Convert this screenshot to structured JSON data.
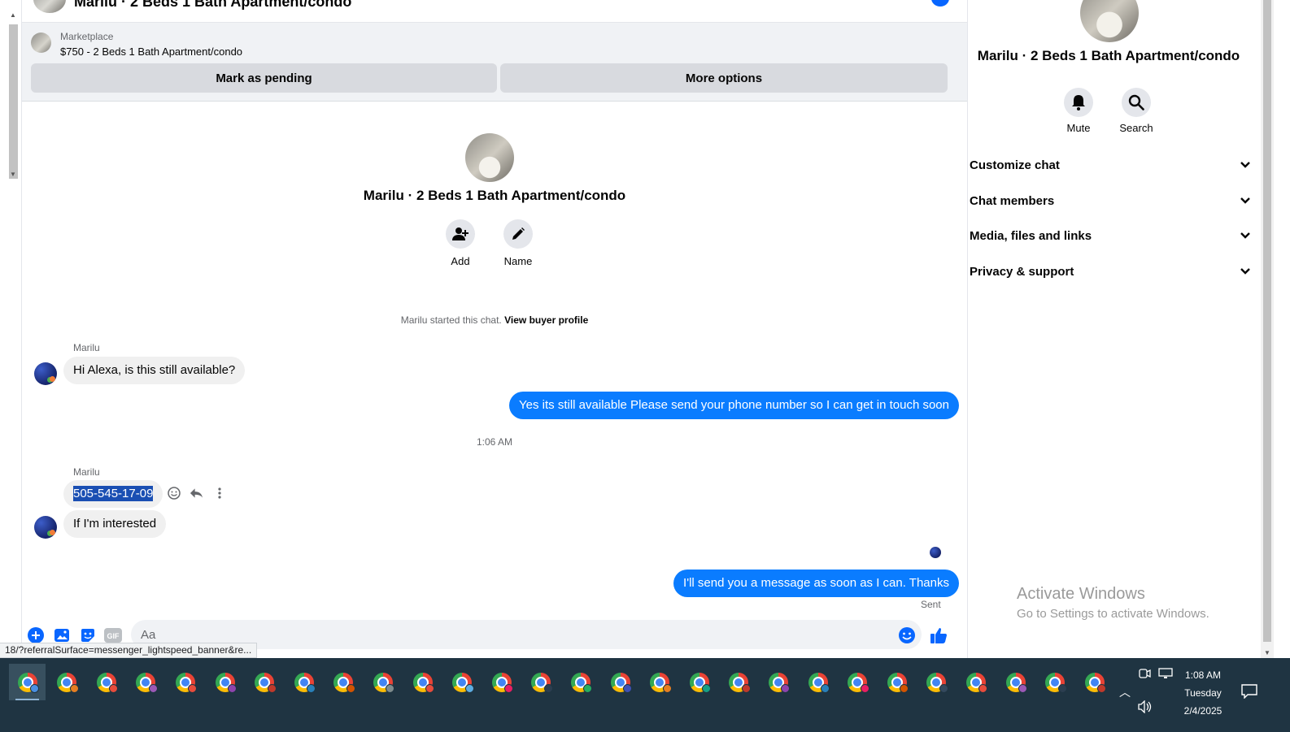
{
  "header": {
    "title": "Marilu · 2 Beds 1 Bath Apartment/condo"
  },
  "marketplace": {
    "label": "Marketplace",
    "item": "$750 - 2 Beds 1 Bath Apartment/condo",
    "mark_pending": "Mark as pending",
    "more_options": "More options"
  },
  "intro": {
    "title": "Marilu · 2 Beds 1 Bath Apartment/condo",
    "add_label": "Add",
    "name_label": "Name",
    "started_text": "Marilu started this chat.",
    "view_profile": "View buyer profile"
  },
  "messages": {
    "sender1": "Marilu",
    "m1": "Hi Alexa, is this still available?",
    "m2": "Yes its still available Please send your phone number so I can get in touch soon",
    "timestamp": "1:06 AM",
    "sender2": "Marilu",
    "m3": "505-545-17-09",
    "m4": "If I'm interested",
    "m5": "I'll send you a message as soon as I can. Thanks",
    "sent_label": "Sent"
  },
  "composer": {
    "placeholder": "Aa"
  },
  "status_url": "18/?referralSurface=messenger_lightspeed_banner&re...",
  "info": {
    "title": "Marilu · 2 Beds 1 Bath Apartment/condo",
    "mute": "Mute",
    "search": "Search",
    "sections": [
      "Customize chat",
      "Chat members",
      "Media, files and links",
      "Privacy & support"
    ]
  },
  "watermark": {
    "line1": "Activate Windows",
    "line2": "Go to Settings to activate Windows."
  },
  "taskbar": {
    "time": "1:08 AM",
    "day": "Tuesday",
    "date": "2/4/2025",
    "profile_colors": [
      "#4a90e2",
      "#e67e22",
      "#e74c3c",
      "#9b59b6",
      "#e74c3c",
      "#8e44ad",
      "#c0392b",
      "#2980b9",
      "#d35400",
      "#7f8c8d",
      "#e74c3c",
      "#5dade2",
      "#e91e63",
      "#2c3e50",
      "#27ae60",
      "#3f51b5",
      "#e67e22",
      "#16a085",
      "#c0392b",
      "#8e44ad",
      "#2980b9",
      "#e91e63",
      "#d35400",
      "#34495e",
      "#e74c3c",
      "#9b59b6",
      "#2c3e50",
      "#c0392b"
    ]
  },
  "colors": {
    "accent": "#0a7cff",
    "taskbar": "#1f3442"
  }
}
